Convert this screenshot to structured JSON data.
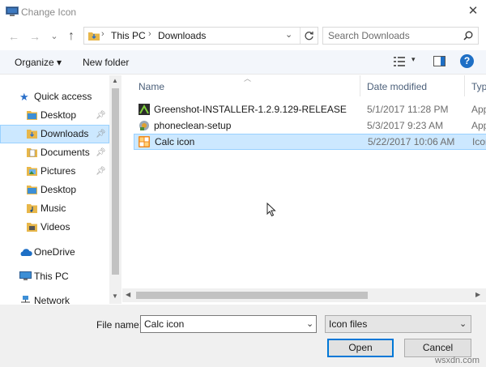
{
  "window": {
    "title": "Change Icon",
    "close_glyph": "✕"
  },
  "nav_buttons": {
    "back": "←",
    "forward": "→",
    "recent": "⌄",
    "up": "↑"
  },
  "address": {
    "segments": [
      "This PC",
      "Downloads"
    ],
    "separator": "›"
  },
  "search": {
    "placeholder": "Search Downloads"
  },
  "toolbar": {
    "organize_label": "Organize ▾",
    "new_folder_label": "New folder",
    "help_glyph": "?"
  },
  "sidebar": {
    "items": [
      {
        "label": "Quick access",
        "icon": "star-icon"
      },
      {
        "label": "Desktop",
        "icon": "folder-icon",
        "pinned": true
      },
      {
        "label": "Downloads",
        "icon": "download-folder-icon",
        "pinned": true,
        "selected": true
      },
      {
        "label": "Documents",
        "icon": "document-folder-icon",
        "pinned": true
      },
      {
        "label": "Pictures",
        "icon": "pictures-folder-icon",
        "pinned": true
      },
      {
        "label": "Desktop",
        "icon": "folder-icon"
      },
      {
        "label": "Music",
        "icon": "music-folder-icon"
      },
      {
        "label": "Videos",
        "icon": "video-folder-icon"
      },
      {
        "label": "OneDrive",
        "icon": "cloud-icon"
      },
      {
        "label": "This PC",
        "icon": "computer-icon"
      },
      {
        "label": "Network",
        "icon": "network-icon"
      }
    ]
  },
  "files": {
    "columns": {
      "name": "Name",
      "date": "Date modified",
      "type": "Typ"
    },
    "rows": [
      {
        "name": "Greenshot-INSTALLER-1.2.9.129-RELEASE",
        "date": "5/1/2017 11:28 PM",
        "type": "App",
        "icon": "installer-icon"
      },
      {
        "name": "phoneclean-setup",
        "date": "5/3/2017 9:23 AM",
        "type": "App",
        "icon": "setup-icon"
      },
      {
        "name": "Calc icon",
        "date": "5/22/2017 10:06 AM",
        "type": "Icon",
        "icon": "calculator-icon",
        "selected": true
      }
    ]
  },
  "footer": {
    "file_name_label": "File name:",
    "file_name_value": "Calc icon",
    "file_type_value": "Icon files",
    "open_label": "Open",
    "cancel_label": "Cancel"
  },
  "watermark": "wsxdn.com",
  "colors": {
    "selection": "#cce8ff",
    "selection_border": "#99d1ff",
    "accent": "#0078d7",
    "folder": "#e8b74a"
  }
}
